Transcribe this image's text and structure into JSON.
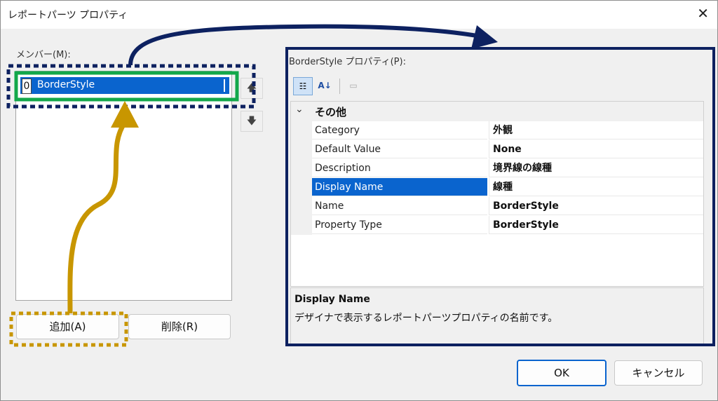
{
  "window": {
    "title": "レポートパーツ プロパティ",
    "close_icon": "close-icon"
  },
  "members": {
    "label": "メンバー(M):",
    "items": [
      {
        "index": "0",
        "name": "BorderStyle",
        "selected": true
      }
    ],
    "move_up_icon": "arrow-up-icon",
    "move_down_icon": "arrow-down-icon"
  },
  "buttons": {
    "add": "追加(A)",
    "delete": "削除(R)",
    "ok": "OK",
    "cancel": "キャンセル"
  },
  "properties": {
    "label": "BorderStyle プロパティ(P):",
    "toolbar": [
      "categorized-icon",
      "alphabetical-icon",
      "property-pages-icon"
    ],
    "category": "その他",
    "rows": [
      {
        "name": "Category",
        "value": "外観"
      },
      {
        "name": "Default Value",
        "value": "None"
      },
      {
        "name": "Description",
        "value": "境界線の線種"
      },
      {
        "name": "Display Name",
        "value": "線種",
        "selected": true
      },
      {
        "name": "Name",
        "value": "BorderStyle"
      },
      {
        "name": "Property Type",
        "value": "BorderStyle"
      }
    ],
    "description": {
      "title": "Display Name",
      "text": "デザイナで表示するレポートパーツプロパティの名前です。"
    }
  },
  "annotation_colors": {
    "navy": "#0d2160",
    "green": "#13a84a",
    "gold": "#c89600"
  }
}
